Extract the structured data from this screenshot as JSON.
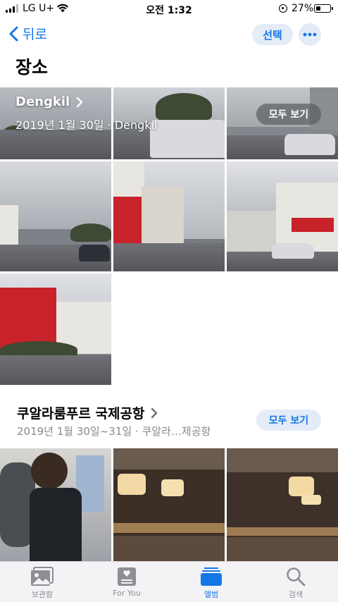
{
  "status_bar": {
    "carrier": "LG U+",
    "time": "오전 1:32",
    "battery": "27%",
    "battery_level": 0.27
  },
  "nav": {
    "back_label": "뒤로",
    "select_label": "선택",
    "title": "장소"
  },
  "section1": {
    "title": "Dengkil",
    "subtitle": "2019년 1월 30일 · Dengkil",
    "see_all": "모두 보기"
  },
  "section2": {
    "title": "쿠알라룸푸르 국제공항",
    "subtitle": "2019년 1월 30일~31일 · 쿠알라…제공항",
    "see_all": "모두 보기"
  },
  "tabs": [
    {
      "label": "보관함",
      "icon": "photos-library-icon"
    },
    {
      "label": "For You",
      "icon": "for-you-icon"
    },
    {
      "label": "앨범",
      "icon": "albums-icon"
    },
    {
      "label": "검색",
      "icon": "search-icon"
    }
  ],
  "active_tab": "앨범",
  "colors": {
    "accent": "#1477e6",
    "inactive": "#8e8e93"
  }
}
